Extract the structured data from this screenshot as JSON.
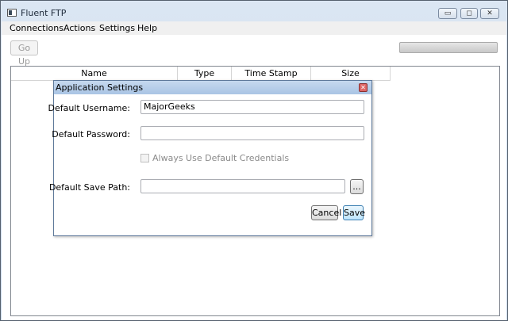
{
  "window": {
    "title": "Fluent FTP",
    "controls": {
      "minimize": "▭",
      "maximize": "◻",
      "close": "✕"
    }
  },
  "menu": [
    "Connections",
    "Actions",
    "Settings",
    "Help"
  ],
  "toolbar": {
    "go_up": "Go Up",
    "progress": 0
  },
  "list": {
    "columns": [
      "Name",
      "Type",
      "Time Stamp",
      "Size"
    ]
  },
  "dialog": {
    "title": "Application Settings",
    "close": "✕",
    "username_label": "Default Username:",
    "username_value": "MajorGeeks",
    "password_label": "Default Password:",
    "password_value": "",
    "checkbox_label": "Always Use Default Credentials",
    "checkbox_checked": false,
    "save_path_label": "Default Save Path:",
    "save_path_value": "",
    "browse": "...",
    "cancel": "Cancel",
    "save": "Save"
  }
}
